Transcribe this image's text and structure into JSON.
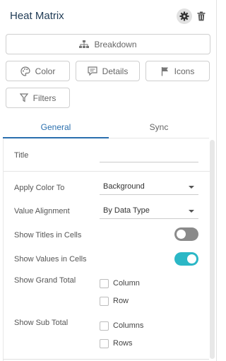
{
  "header": {
    "title": "Heat Matrix"
  },
  "buttons": {
    "breakdown": "Breakdown",
    "color": "Color",
    "details": "Details",
    "icons": "Icons",
    "filters": "Filters"
  },
  "tabs": [
    {
      "label": "General",
      "active": true
    },
    {
      "label": "Sync",
      "active": false
    }
  ],
  "settings": {
    "title_label": "Title",
    "title_value": "",
    "apply_color_to": {
      "label": "Apply Color To",
      "value": "Background"
    },
    "value_alignment": {
      "label": "Value Alignment",
      "value": "By Data Type"
    },
    "show_titles_in_cells": {
      "label": "Show Titles in Cells",
      "on": false
    },
    "show_values_in_cells": {
      "label": "Show Values in Cells",
      "on": true
    },
    "show_grand_total": {
      "label": "Show Grand Total",
      "options": [
        "Column",
        "Row"
      ]
    },
    "show_sub_total": {
      "label": "Show Sub Total",
      "options": [
        "Columns",
        "Rows"
      ]
    }
  },
  "colors": {
    "accent": "#2a6fae",
    "toggle_on": "#2bb7c6",
    "toggle_off": "#8a8a8a"
  },
  "icons": [
    "gear-icon",
    "trash-icon",
    "breakdown-icon",
    "palette-icon",
    "details-icon",
    "flag-icon",
    "filter-icon"
  ]
}
